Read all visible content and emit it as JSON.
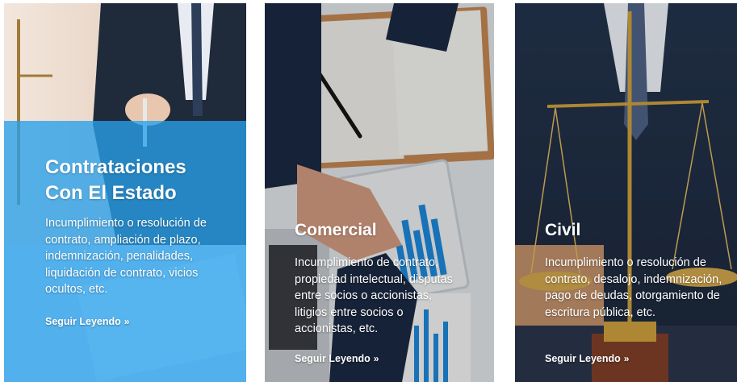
{
  "cards": [
    {
      "title_line1": "Contrataciones",
      "title_line2": "Con El Estado",
      "description": "Incumplimiento o resolución de contrato, ampliación de plazo, indemnización, penalidades, liquidación de contrato, vicios ocultos, etc.",
      "link_label": "Seguir Leyendo",
      "link_icon": "double-chevron-right-icon",
      "image": "businessman-signing-document-with-scales-of-justice"
    },
    {
      "title": "Comercial",
      "description": "Incumplimiento de contrato, propiedad intelectual, disputas entre socios o accionistas, litigios entre socios o accionistas, etc.",
      "link_label": "Seguir Leyendo",
      "link_icon": "double-chevron-right-icon",
      "image": "business-handshake-over-desk-with-charts"
    },
    {
      "title": "Civil",
      "description": "Incumplimiento o resolución de contrato, desalojo, indemnización, pago de deudas, otorgamiento de escritura pública, etc.",
      "link_label": "Seguir Leyendo",
      "link_icon": "double-chevron-right-icon",
      "image": "lawyer-with-golden-scales-of-justice"
    }
  ],
  "colors": {
    "overlay_blue": "#28a0eb",
    "text": "#ffffff"
  }
}
